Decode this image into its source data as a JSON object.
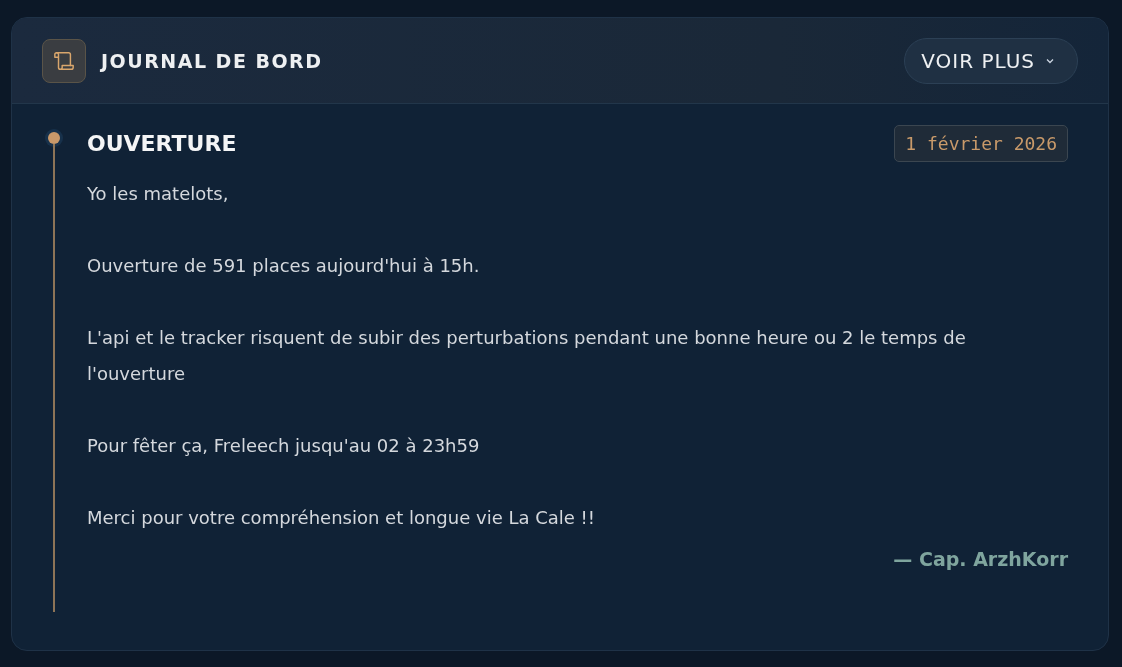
{
  "header": {
    "title": "JOURNAL DE BORD",
    "more_button": {
      "label": "VOIR PLUS",
      "expanded": false
    }
  },
  "entries": [
    {
      "title": "OUVERTURE",
      "date": "1 février 2026",
      "paragraphs": [
        "Yo les matelots,",
        "Ouverture de 591 places aujourd'hui à 15h.",
        "L'api et le tracker risquent de subir des perturbations pendant une bonne heure ou 2 le temps de l'ouverture",
        "Pour fêter ça, Freleech jusqu'au 02 à 23h59",
        "Merci pour votre compréhension et longue vie La Cale !!"
      ],
      "signature": "— Cap. ArzhKorr"
    }
  ]
}
